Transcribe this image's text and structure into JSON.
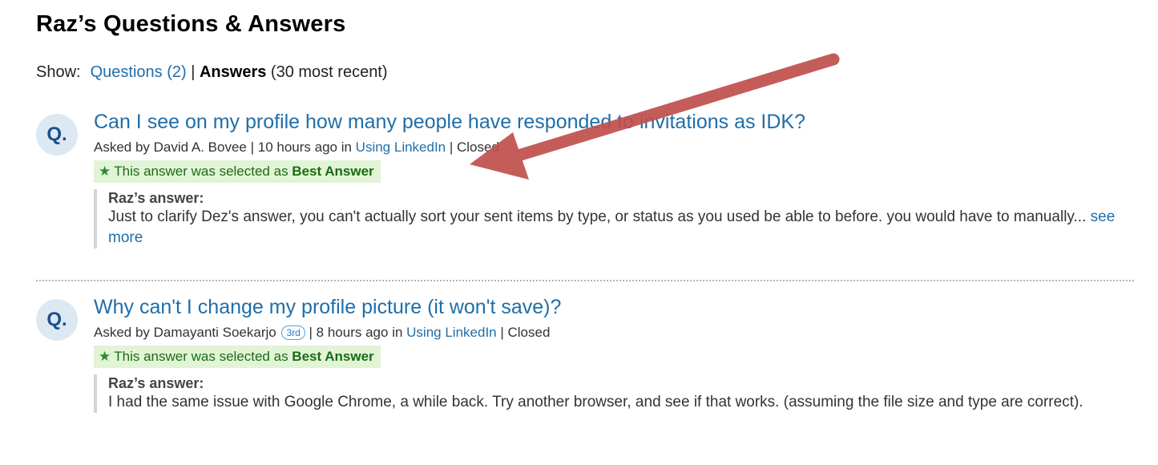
{
  "page": {
    "title": "Raz’s Questions & Answers"
  },
  "filter": {
    "show_label": "Show:",
    "questions_link": "Questions (2)",
    "separator": "|",
    "answers_label": "Answers",
    "answers_note": "(30 most recent)"
  },
  "items": [
    {
      "badge": "Q.",
      "title": "Can I see on my profile how many people have responded to invitations as IDK?",
      "asked_by": "Asked by David A. Bovee | 10 hours ago in ",
      "category": "Using LinkedIn",
      "status": " | Closed",
      "best_prefix": "This answer was selected as ",
      "best_label": "Best Answer",
      "answer_by": "Raz’s answer:",
      "answer_text": "Just to clarify Dez's answer, you can't actually sort your sent items by type, or status as you used be able to before. you would have to manually...",
      "see_more": "see more"
    },
    {
      "badge": "Q.",
      "title": "Why can't I change my profile picture (it won't save)?",
      "asked_by": "Asked by Damayanti Soekarjo",
      "degree": "3rd",
      "asked_when": " | 8 hours ago in ",
      "category": "Using LinkedIn",
      "status": " | Closed",
      "best_prefix": "This answer was selected as ",
      "best_label": "Best Answer",
      "answer_by": "Raz’s answer:",
      "answer_text": "I had the same issue with Google Chrome, a while back. Try another browser, and see if that works. (assuming the file size and type are correct)."
    }
  ],
  "colors": {
    "link": "#1f6ea8",
    "best_bg": "#e1f4d6",
    "arrow": "#c0504d"
  },
  "icons": {
    "star": "star-icon",
    "arrow": "annotation-arrow"
  }
}
